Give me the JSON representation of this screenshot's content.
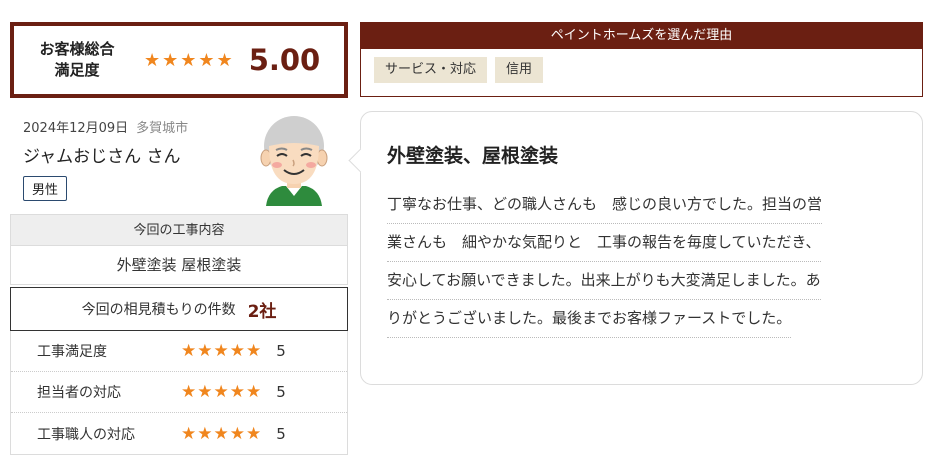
{
  "overall": {
    "label_line1": "お客様総合",
    "label_line2": "満足度",
    "stars": "★★★★★",
    "score": "5.00"
  },
  "reason": {
    "header": "ペイントホームズを選んだ理由",
    "tags": [
      "サービス・対応",
      "信用"
    ]
  },
  "reviewer": {
    "date": "2024年12月09日",
    "city": "多賀城市",
    "name": "ジャムおじさん さん",
    "gender": "男性"
  },
  "work": {
    "header": "今回の工事内容",
    "content": "外壁塗装 屋根塗装"
  },
  "quotes": {
    "label": "今回の相見積もりの件数",
    "count": "2社"
  },
  "ratings": [
    {
      "label": "工事満足度",
      "stars": "★★★★★",
      "value": "5"
    },
    {
      "label": "担当者の対応",
      "stars": "★★★★★",
      "value": "5"
    },
    {
      "label": "工事職人の対応",
      "stars": "★★★★★",
      "value": "5"
    }
  ],
  "review": {
    "title": "外壁塗装、屋根塗装",
    "lines": [
      "丁寧なお仕事、どの職人さんも　感じの良い方でした。担当の営",
      "業さんも　細やかな気配りと　工事の報告を毎度していただき、",
      "安心してお願いできました。出来上がりも大変満足しました。あ",
      "りがとうございました。最後までお客様ファーストでした。"
    ]
  },
  "colors": {
    "brand": "#6b1f12",
    "star": "#f0861e",
    "tag_bg": "#ece5d3"
  },
  "icons": {
    "avatar": "smiling-elderly-man-avatar"
  }
}
